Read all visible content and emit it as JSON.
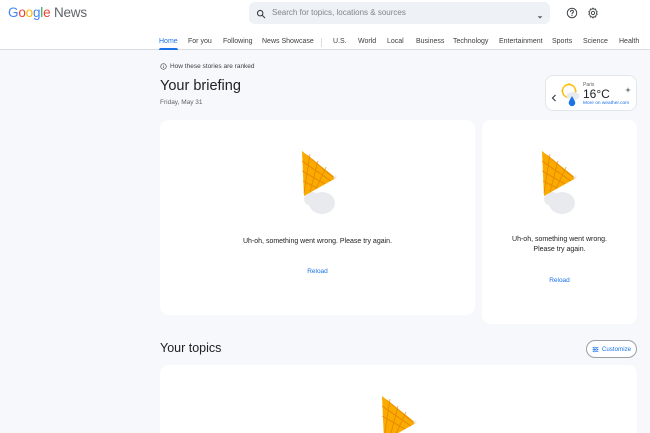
{
  "logo": {
    "google": [
      "G",
      "o",
      "o",
      "g",
      "l",
      "e"
    ],
    "product": "News"
  },
  "search": {
    "placeholder": "Search for topics, locations & sources"
  },
  "header_icons": [
    "help-icon",
    "settings-icon"
  ],
  "tabs": [
    {
      "label": "Home",
      "active": true
    },
    {
      "label": "For you"
    },
    {
      "label": "Following"
    },
    {
      "label": "News Showcase"
    },
    {
      "label": "U.S."
    },
    {
      "label": "World"
    },
    {
      "label": "Local"
    },
    {
      "label": "Business"
    },
    {
      "label": "Technology"
    },
    {
      "label": "Entertainment"
    },
    {
      "label": "Sports"
    },
    {
      "label": "Science"
    },
    {
      "label": "Health"
    }
  ],
  "briefing": {
    "ranked_link": "How these stories are ranked",
    "title": "Your briefing",
    "date": "Friday, May 31"
  },
  "weather": {
    "city": "Paris",
    "temperature": "16°C",
    "link": "More on weather.com"
  },
  "cards": [
    {
      "error": "Uh-oh, something went wrong. Please try again.",
      "action": "Reload"
    },
    {
      "error_line1": "Uh-oh, something went wrong.",
      "error_line2": "Please try again.",
      "action": "Reload"
    }
  ],
  "topics": {
    "title": "Your topics",
    "customize": "Customize"
  },
  "colors": {
    "accent": "#1a73e8",
    "cone": "#f9ab00",
    "page_bg": "#f6f8fc"
  }
}
